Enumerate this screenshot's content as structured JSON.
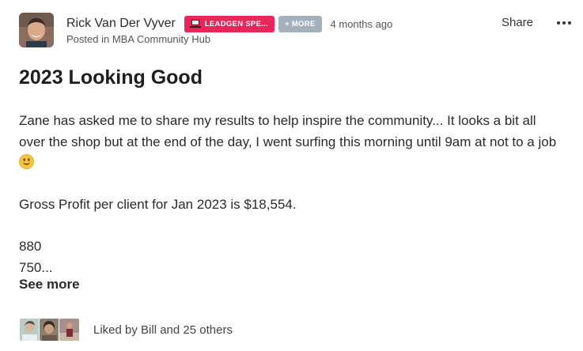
{
  "post": {
    "author": {
      "name": "Rick Van Der Vyver",
      "avatar_icon": "user-photo-avatar"
    },
    "badges": [
      {
        "label": "LEADGEN SPE...",
        "icon": "laptop-icon",
        "color": "#e8265b"
      },
      {
        "label": "+ MORE",
        "color": "#a5b0bd"
      }
    ],
    "time": "4 months ago",
    "posted_in": "Posted in MBA Community Hub",
    "actions": {
      "share_label": "Share",
      "more_icon": "more-horizontal-icon"
    },
    "title": "2023 Looking Good",
    "body": {
      "paragraph_1": "Zane has asked me to share my results to help inspire the community... It looks a bit all over the shop  but at the end of the day, I went surfing this morning until 9am at not to a job",
      "emoji": "smile-icon",
      "paragraph_2": "Gross Profit per client for Jan 2023 is $18,554.",
      "line_3": "880",
      "line_4": "750..."
    },
    "see_more_label": "See more",
    "likes": {
      "avatars": [
        "liker-avatar-1",
        "liker-avatar-2",
        "liker-avatar-3"
      ],
      "text": "Liked by Bill and 25 others"
    }
  }
}
